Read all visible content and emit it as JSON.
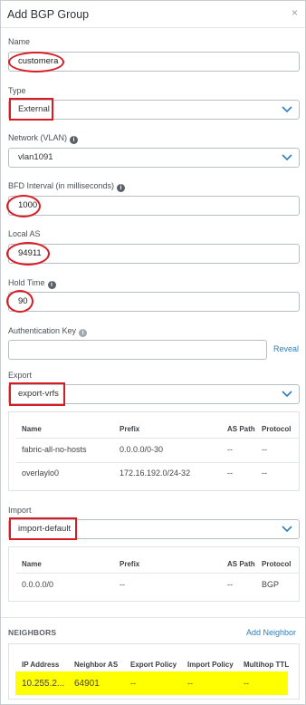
{
  "header": {
    "title": "Add BGP Group",
    "close_glyph": "×"
  },
  "name": {
    "label": "Name",
    "value": "customera"
  },
  "type": {
    "label": "Type",
    "value": "External"
  },
  "network": {
    "label": "Network (VLAN)",
    "value": "vlan1091"
  },
  "bfd": {
    "label": "BFD Interval (in milliseconds)",
    "value": "1000"
  },
  "local_as": {
    "label": "Local AS",
    "value": "94911"
  },
  "hold_time": {
    "label": "Hold Time",
    "value": "90"
  },
  "auth": {
    "label": "Authentication Key",
    "value": "",
    "reveal": "Reveal"
  },
  "export": {
    "label": "Export",
    "value": "export-vrfs",
    "headers": [
      "Name",
      "Prefix",
      "AS Path",
      "Protocol"
    ],
    "rows": [
      [
        "fabric-all-no-hosts",
        "0.0.0.0/0-30",
        "--",
        "--"
      ],
      [
        "overlaylo0",
        "172.16.192.0/24-32",
        "--",
        "--"
      ]
    ]
  },
  "import": {
    "label": "Import",
    "value": "import-default",
    "headers": [
      "Name",
      "Prefix",
      "AS Path",
      "Protocol"
    ],
    "rows": [
      [
        "0.0.0.0/0",
        "--",
        "--",
        "BGP"
      ]
    ]
  },
  "neighbors": {
    "label": "NEIGHBORS",
    "add": "Add Neighbor",
    "headers": [
      "IP Address",
      "Neighbor AS",
      "Export Policy",
      "Import Policy",
      "Multihop TTL"
    ],
    "rows": [
      [
        "10.255.2...",
        "64901",
        "--",
        "--",
        "--"
      ]
    ],
    "highlight_color": "#ffff00"
  },
  "icons": {
    "info": "info-icon",
    "chevron": "chevron-down-icon",
    "close": "close-icon"
  },
  "colors": {
    "link": "#2a7fc1",
    "annotation": "#d81c24",
    "highlight": "#ffff00"
  }
}
